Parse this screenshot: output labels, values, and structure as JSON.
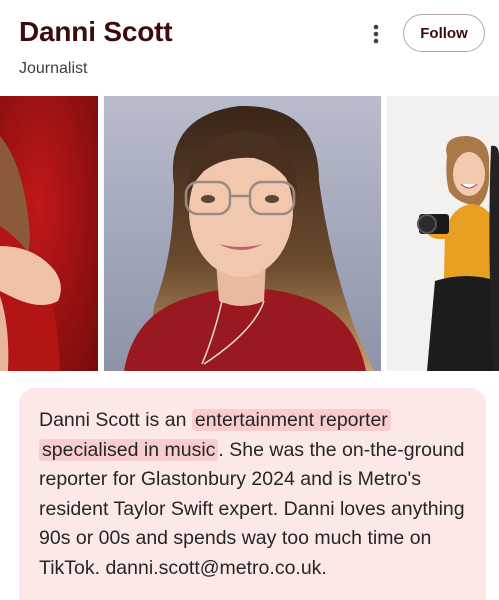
{
  "header": {
    "title": "Danni Scott",
    "subtitle": "Journalist",
    "follow_label": "Follow",
    "more_icon": "more-vert-icon"
  },
  "carousel": {
    "images": [
      {
        "name": "photo-red-background"
      },
      {
        "name": "photo-portrait-red-sweater"
      },
      {
        "name": "photo-with-camera"
      }
    ]
  },
  "bio": {
    "prefix": "Danni Scott is an ",
    "highlight": "entertainment reporter specialised in music",
    "suffix": ". She was the on-the-ground reporter for Glastonbury 2024 and is Metro's resident Taylor Swift expert. Danni loves anything 90s or 00s and spends way too much time on TikTok. danni.scott@metro.co.uk."
  },
  "colors": {
    "title": "#3c0b0b",
    "bio_background": "#fce8e6",
    "highlight": "#f7cdcd"
  }
}
